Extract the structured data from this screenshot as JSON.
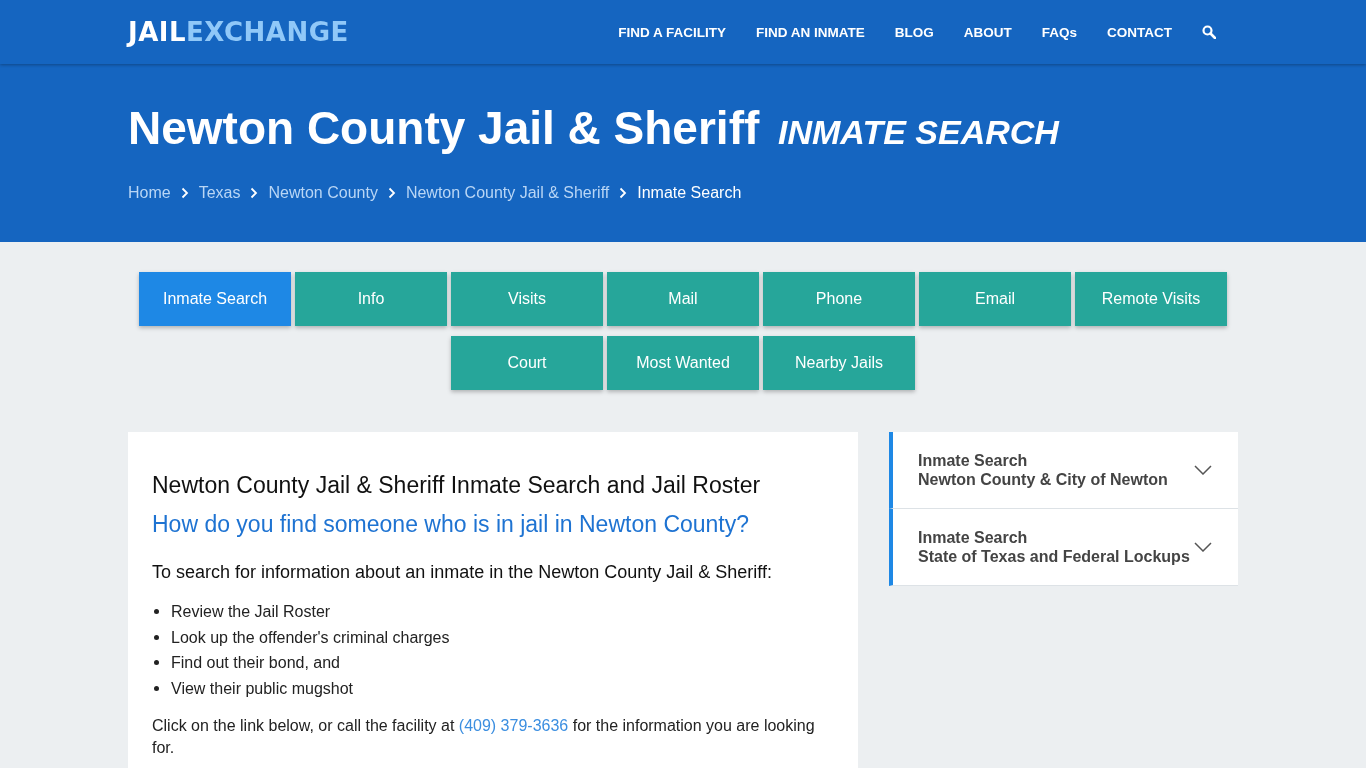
{
  "logo": {
    "first": "JAIL",
    "second": "EXCHANGE"
  },
  "nav": [
    "FIND A FACILITY",
    "FIND AN INMATE",
    "BLOG",
    "ABOUT",
    "FAQs",
    "CONTACT"
  ],
  "hero": {
    "title": "Newton County Jail & Sheriff",
    "subtitle": "INMATE SEARCH"
  },
  "breadcrumbs": [
    {
      "label": "Home",
      "current": false
    },
    {
      "label": "Texas",
      "current": false
    },
    {
      "label": "Newton County",
      "current": false
    },
    {
      "label": "Newton County Jail & Sheriff",
      "current": false
    },
    {
      "label": "Inmate Search",
      "current": true
    }
  ],
  "tabs": [
    {
      "label": "Inmate Search",
      "selected": true
    },
    {
      "label": "Info",
      "selected": false
    },
    {
      "label": "Visits",
      "selected": false
    },
    {
      "label": "Mail",
      "selected": false
    },
    {
      "label": "Phone",
      "selected": false
    },
    {
      "label": "Email",
      "selected": false
    },
    {
      "label": "Remote Visits",
      "selected": false
    },
    {
      "label": "Court",
      "selected": false
    },
    {
      "label": "Most Wanted",
      "selected": false
    },
    {
      "label": "Nearby Jails",
      "selected": false
    }
  ],
  "article": {
    "heading": "Newton County Jail & Sheriff Inmate Search and Jail Roster",
    "question": "How do you find someone who is in jail in Newton County?",
    "intro": "To search for information about an inmate in the Newton County Jail & Sheriff:",
    "bullets": [
      "Review the Jail Roster",
      "Look up the offender's criminal charges",
      "Find out their bond, and",
      "View their public mugshot"
    ],
    "paragraph": {
      "before": "Click on the link below, or call the facility at",
      "phone": "(409) 379-3636",
      "after": "for the information you are looking for."
    }
  },
  "sidebar": [
    {
      "title": "Inmate Search",
      "subtitle": "Newton County & City of Newton",
      "expanded": false
    },
    {
      "title": "Inmate Search",
      "subtitle": "State of Texas and Federal Lockups",
      "expanded": false
    }
  ]
}
